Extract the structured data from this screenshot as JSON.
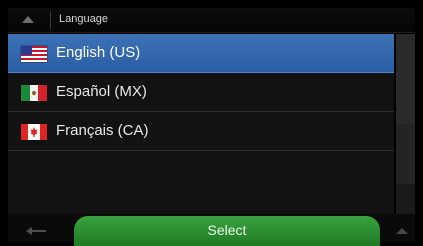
{
  "header": {
    "title": "Language",
    "up_icon": "chevron-up-icon"
  },
  "languages": [
    {
      "label": "English (US)",
      "flag": "us-flag-icon",
      "selected": true
    },
    {
      "label": "Español (MX)",
      "flag": "mx-flag-icon",
      "selected": false
    },
    {
      "label": "Français (CA)",
      "flag": "ca-flag-icon",
      "selected": false
    }
  ],
  "footer": {
    "select_label": "Select",
    "back_icon": "back-arrow-icon",
    "up_icon": "scroll-up-icon"
  },
  "colors": {
    "selected_row": "#2f64a9",
    "select_button": "#2e9133",
    "background": "#121212"
  }
}
